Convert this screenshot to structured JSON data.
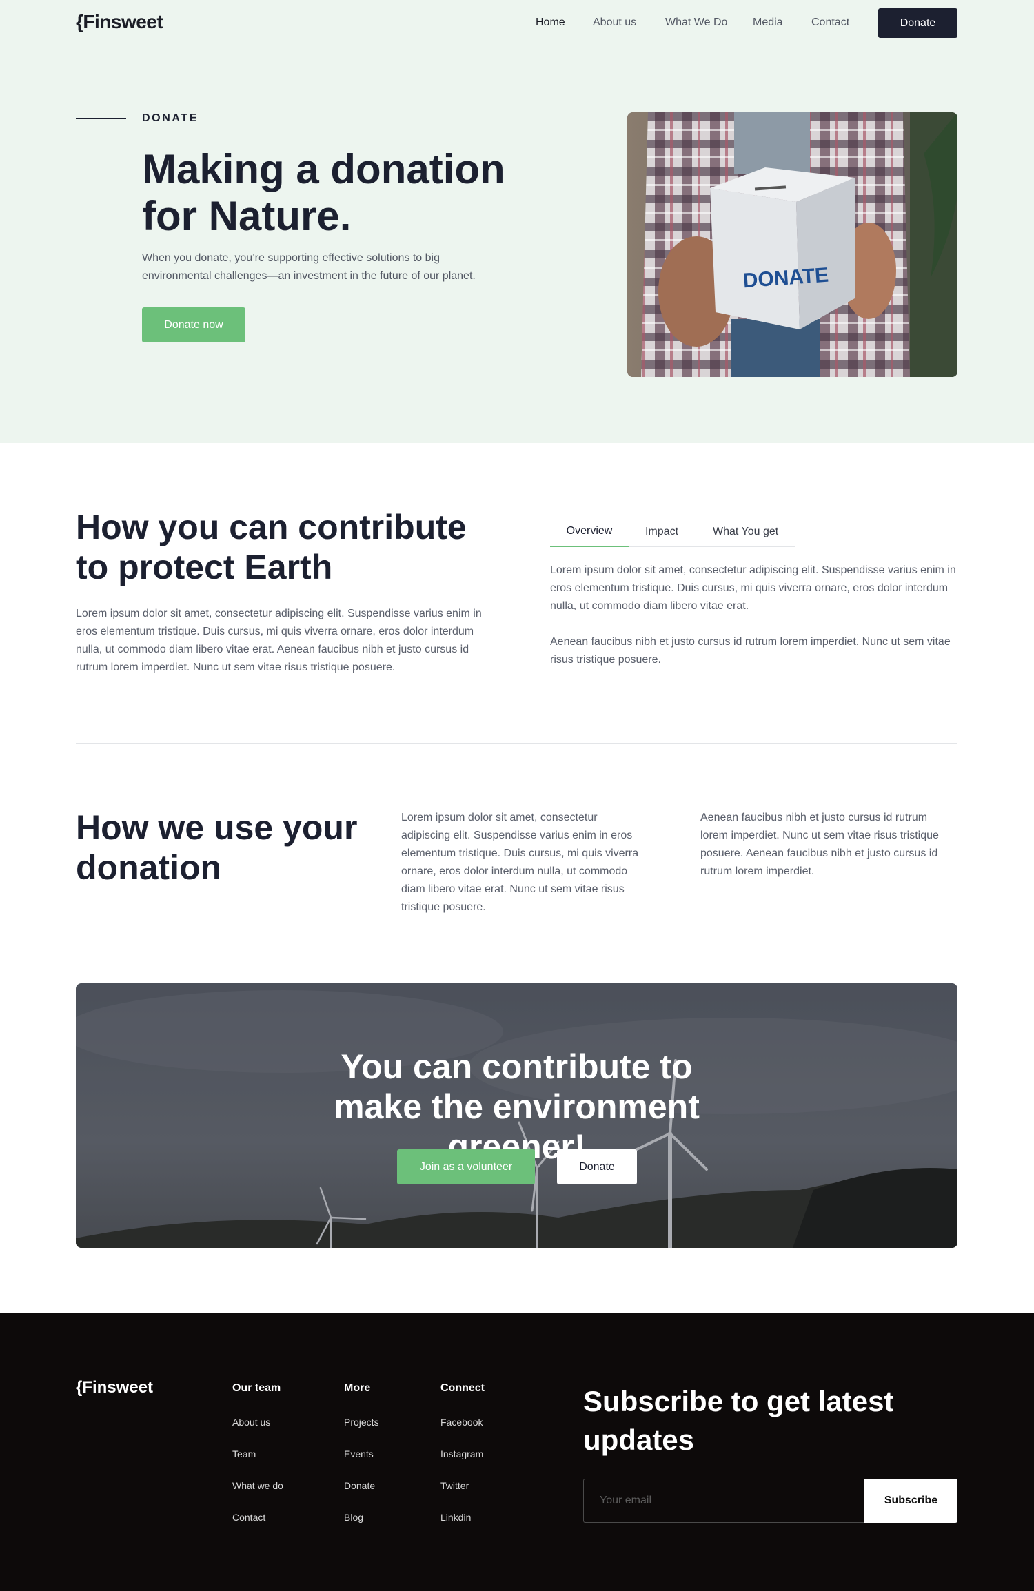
{
  "brand": {
    "logo": "{Finsweet",
    "footer_logo": "{Finsweet"
  },
  "nav": {
    "items": [
      {
        "label": "Home",
        "active": true
      },
      {
        "label": "About us"
      },
      {
        "label": "What We Do"
      },
      {
        "label": "Media"
      },
      {
        "label": "Contact"
      }
    ],
    "cta_label": "Donate"
  },
  "hero": {
    "eyebrow": "DONATE",
    "title": "Making a donation for Nature.",
    "text": "When you donate, you’re supporting effective solutions to big environmental challenges—an investment in the future of our planet.",
    "button": "Donate now",
    "image_box_text": "DONATE"
  },
  "contribute": {
    "title": "How you can contribute to protect Earth",
    "text": "Lorem ipsum dolor sit amet, consectetur adipiscing elit. Suspendisse varius enim in eros elementum tristique. Duis cursus, mi quis viverra ornare, eros dolor interdum nulla, ut commodo diam libero vitae erat. Aenean faucibus nibh et justo cursus id rutrum lorem imperdiet. Nunc ut sem vitae risus tristique posuere.",
    "tabs": [
      {
        "label": "Overview",
        "active": true
      },
      {
        "label": "Impact"
      },
      {
        "label": "What You get"
      }
    ],
    "tab_paragraph_1": "Lorem ipsum dolor sit amet, consectetur adipiscing elit. Suspendisse varius enim in eros elementum tristique. Duis cursus, mi quis viverra ornare, eros dolor interdum nulla, ut commodo diam libero vitae erat.",
    "tab_paragraph_2": "Aenean faucibus nibh et justo cursus id rutrum lorem imperdiet. Nunc ut sem vitae risus tristique posuere."
  },
  "usage": {
    "title": "How we use your donation",
    "col1": "Lorem ipsum dolor sit amet, consectetur adipiscing elit. Suspendisse varius enim in eros elementum tristique. Duis cursus, mi quis viverra ornare, eros dolor interdum nulla, ut commodo diam libero vitae erat.  Nunc ut sem vitae risus tristique posuere.",
    "col2": "Aenean faucibus nibh et justo cursus id rutrum lorem imperdiet. Nunc ut sem vitae risus tristique posuere. Aenean faucibus nibh et justo cursus id rutrum lorem imperdiet."
  },
  "cta": {
    "title": "You can contribute to make the environment greener!",
    "volunteer": "Join as a volunteer",
    "donate": "Donate"
  },
  "footer": {
    "columns": [
      {
        "heading": "Our team",
        "links": [
          "About us",
          "Team",
          "What we do",
          "Contact"
        ]
      },
      {
        "heading": "More",
        "links": [
          "Projects",
          "Events",
          "Donate",
          "Blog"
        ]
      },
      {
        "heading": "Connect",
        "links": [
          "Facebook",
          "Instagram",
          "Twitter",
          "Linkdin"
        ]
      }
    ],
    "subscribe_title": "Subscribe to get latest updates",
    "email_placeholder": "Your email",
    "subscribe_button": "Subscribe"
  },
  "colors": {
    "accent": "#6cc07a",
    "dark": "#1c2030",
    "hero_bg": "#edf5ef",
    "footer_bg": "#0d0a0a"
  },
  "icons": [
    "donation-box-image",
    "wind-turbine-image"
  ]
}
